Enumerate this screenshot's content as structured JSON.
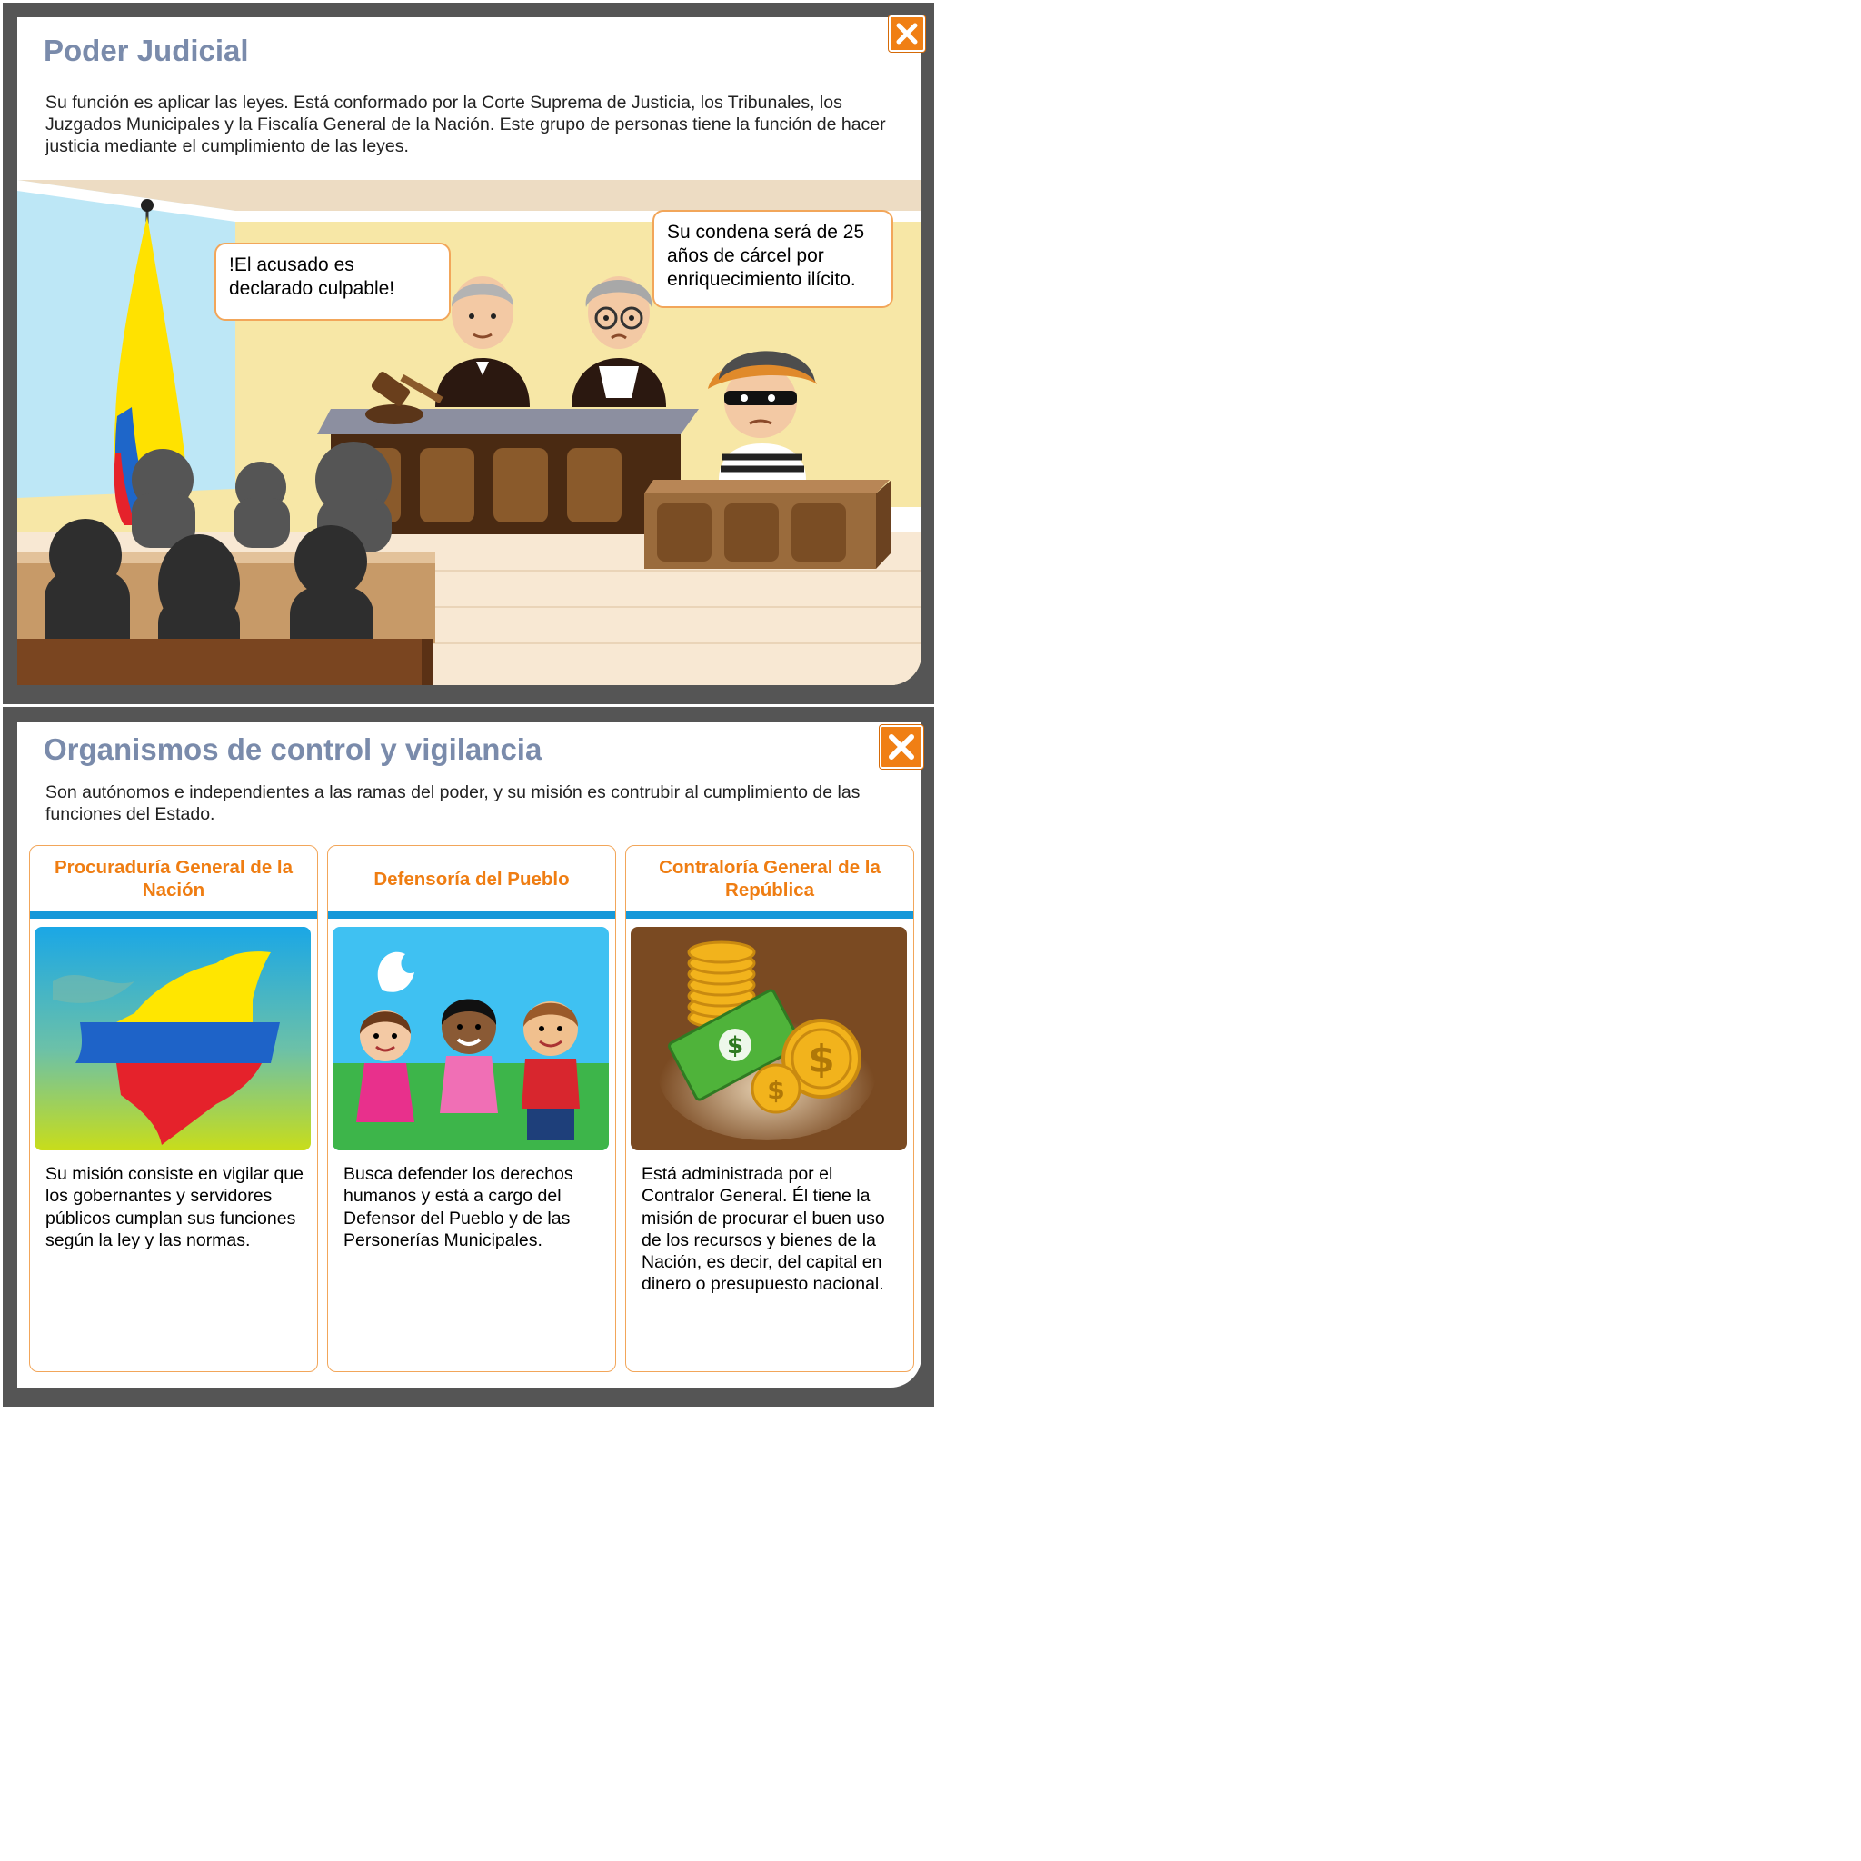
{
  "judicial": {
    "title": "Poder Judicial",
    "intro": "Su función es aplicar las leyes. Está conformado por la Corte Suprema de Justicia, los Tribunales, los Juzgados Municipales y la Fiscalía General de la Nación. Este grupo de personas tiene la función de hacer justicia mediante el cumplimiento de las leyes.",
    "bubble_left": "!El acusado es declarado culpable!",
    "bubble_right": "Su condena será de 25 años de cárcel por enriquecimiento ilícito."
  },
  "organismos": {
    "title": "Organismos de control y vigilancia",
    "intro": "Son autónomos e independientes a las ramas del poder, y su misión es contrubir al cumplimiento de las funciones del Estado.",
    "columns": [
      {
        "heading": "Procuraduría General de la Nación",
        "text": "Su misión consiste en vigilar que los gobernantes  y servidores públicos cumplan sus funciones según la ley y las normas."
      },
      {
        "heading": "Defensoría del Pueblo",
        "text": "Busca defender los derechos humanos y está a cargo del Defensor del Pueblo y de las Personerías Municipales."
      },
      {
        "heading": "Contraloría General de la República",
        "text": "Está administrada por el Contralor General. Él tiene la misión de procurar el buen uso de los recursos y bienes de la Nación, es decir, del capital en dinero o presupuesto nacional."
      }
    ]
  },
  "colors": {
    "accent": "#f07f14",
    "title": "#7a8bab",
    "heading": "#ef7d12",
    "bar": "#1598d9",
    "frame": "#555555"
  },
  "icons": {
    "close": "close-icon"
  }
}
